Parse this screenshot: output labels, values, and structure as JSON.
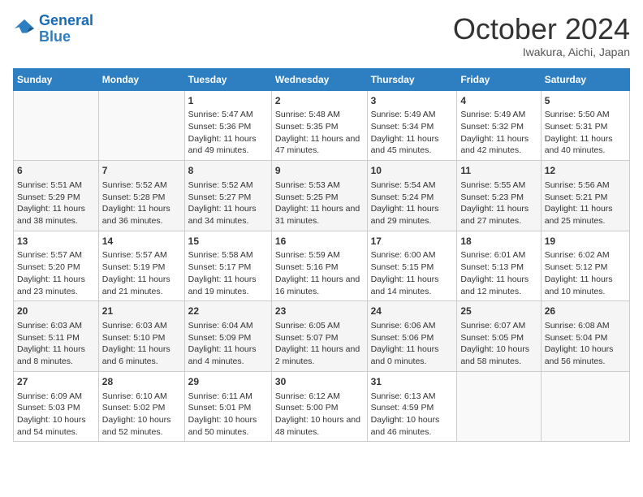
{
  "header": {
    "logo_line1": "General",
    "logo_line2": "Blue",
    "month": "October 2024",
    "location": "Iwakura, Aichi, Japan"
  },
  "weekdays": [
    "Sunday",
    "Monday",
    "Tuesday",
    "Wednesday",
    "Thursday",
    "Friday",
    "Saturday"
  ],
  "weeks": [
    [
      {
        "day": "",
        "info": ""
      },
      {
        "day": "",
        "info": ""
      },
      {
        "day": "1",
        "info": "Sunrise: 5:47 AM\nSunset: 5:36 PM\nDaylight: 11 hours and 49 minutes."
      },
      {
        "day": "2",
        "info": "Sunrise: 5:48 AM\nSunset: 5:35 PM\nDaylight: 11 hours and 47 minutes."
      },
      {
        "day": "3",
        "info": "Sunrise: 5:49 AM\nSunset: 5:34 PM\nDaylight: 11 hours and 45 minutes."
      },
      {
        "day": "4",
        "info": "Sunrise: 5:49 AM\nSunset: 5:32 PM\nDaylight: 11 hours and 42 minutes."
      },
      {
        "day": "5",
        "info": "Sunrise: 5:50 AM\nSunset: 5:31 PM\nDaylight: 11 hours and 40 minutes."
      }
    ],
    [
      {
        "day": "6",
        "info": "Sunrise: 5:51 AM\nSunset: 5:29 PM\nDaylight: 11 hours and 38 minutes."
      },
      {
        "day": "7",
        "info": "Sunrise: 5:52 AM\nSunset: 5:28 PM\nDaylight: 11 hours and 36 minutes."
      },
      {
        "day": "8",
        "info": "Sunrise: 5:52 AM\nSunset: 5:27 PM\nDaylight: 11 hours and 34 minutes."
      },
      {
        "day": "9",
        "info": "Sunrise: 5:53 AM\nSunset: 5:25 PM\nDaylight: 11 hours and 31 minutes."
      },
      {
        "day": "10",
        "info": "Sunrise: 5:54 AM\nSunset: 5:24 PM\nDaylight: 11 hours and 29 minutes."
      },
      {
        "day": "11",
        "info": "Sunrise: 5:55 AM\nSunset: 5:23 PM\nDaylight: 11 hours and 27 minutes."
      },
      {
        "day": "12",
        "info": "Sunrise: 5:56 AM\nSunset: 5:21 PM\nDaylight: 11 hours and 25 minutes."
      }
    ],
    [
      {
        "day": "13",
        "info": "Sunrise: 5:57 AM\nSunset: 5:20 PM\nDaylight: 11 hours and 23 minutes."
      },
      {
        "day": "14",
        "info": "Sunrise: 5:57 AM\nSunset: 5:19 PM\nDaylight: 11 hours and 21 minutes."
      },
      {
        "day": "15",
        "info": "Sunrise: 5:58 AM\nSunset: 5:17 PM\nDaylight: 11 hours and 19 minutes."
      },
      {
        "day": "16",
        "info": "Sunrise: 5:59 AM\nSunset: 5:16 PM\nDaylight: 11 hours and 16 minutes."
      },
      {
        "day": "17",
        "info": "Sunrise: 6:00 AM\nSunset: 5:15 PM\nDaylight: 11 hours and 14 minutes."
      },
      {
        "day": "18",
        "info": "Sunrise: 6:01 AM\nSunset: 5:13 PM\nDaylight: 11 hours and 12 minutes."
      },
      {
        "day": "19",
        "info": "Sunrise: 6:02 AM\nSunset: 5:12 PM\nDaylight: 11 hours and 10 minutes."
      }
    ],
    [
      {
        "day": "20",
        "info": "Sunrise: 6:03 AM\nSunset: 5:11 PM\nDaylight: 11 hours and 8 minutes."
      },
      {
        "day": "21",
        "info": "Sunrise: 6:03 AM\nSunset: 5:10 PM\nDaylight: 11 hours and 6 minutes."
      },
      {
        "day": "22",
        "info": "Sunrise: 6:04 AM\nSunset: 5:09 PM\nDaylight: 11 hours and 4 minutes."
      },
      {
        "day": "23",
        "info": "Sunrise: 6:05 AM\nSunset: 5:07 PM\nDaylight: 11 hours and 2 minutes."
      },
      {
        "day": "24",
        "info": "Sunrise: 6:06 AM\nSunset: 5:06 PM\nDaylight: 11 hours and 0 minutes."
      },
      {
        "day": "25",
        "info": "Sunrise: 6:07 AM\nSunset: 5:05 PM\nDaylight: 10 hours and 58 minutes."
      },
      {
        "day": "26",
        "info": "Sunrise: 6:08 AM\nSunset: 5:04 PM\nDaylight: 10 hours and 56 minutes."
      }
    ],
    [
      {
        "day": "27",
        "info": "Sunrise: 6:09 AM\nSunset: 5:03 PM\nDaylight: 10 hours and 54 minutes."
      },
      {
        "day": "28",
        "info": "Sunrise: 6:10 AM\nSunset: 5:02 PM\nDaylight: 10 hours and 52 minutes."
      },
      {
        "day": "29",
        "info": "Sunrise: 6:11 AM\nSunset: 5:01 PM\nDaylight: 10 hours and 50 minutes."
      },
      {
        "day": "30",
        "info": "Sunrise: 6:12 AM\nSunset: 5:00 PM\nDaylight: 10 hours and 48 minutes."
      },
      {
        "day": "31",
        "info": "Sunrise: 6:13 AM\nSunset: 4:59 PM\nDaylight: 10 hours and 46 minutes."
      },
      {
        "day": "",
        "info": ""
      },
      {
        "day": "",
        "info": ""
      }
    ]
  ]
}
